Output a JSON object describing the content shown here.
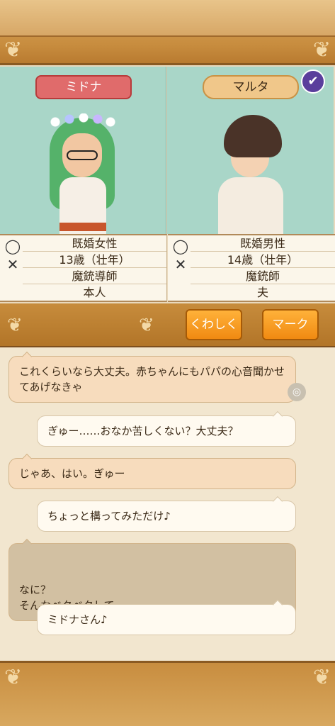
{
  "characters": {
    "left": {
      "name": "ミドナ",
      "info": [
        "既婚女性",
        "13歳（壮年）",
        "魔銃導師",
        "本人"
      ]
    },
    "right": {
      "name": "マルタ",
      "info": [
        "既婚男性",
        "14歳（壮年）",
        "魔銃師",
        "夫"
      ]
    }
  },
  "icons": {
    "check": "check-icon",
    "ring": "ring-icon",
    "crossed": "crossed-weapons-icon",
    "ornament": "ornament-icon"
  },
  "actions": {
    "details_label": "くわしく",
    "mark_label": "マーク"
  },
  "chat": [
    {
      "side": "partner",
      "text": "これくらいなら大丈夫。赤ちゃんにもパパの心音聞かせてあげなきゃ"
    },
    {
      "side": "self",
      "text": "ぎゅー……おなか苦しくない？大丈夫？"
    },
    {
      "side": "partner",
      "text": "じゃあ、はい。ぎゅー"
    },
    {
      "side": "self",
      "text": "ちょっと構ってみただけ♪"
    },
    {
      "side": "partner",
      "text": "なに？\nそんなベタベタして……"
    },
    {
      "side": "self",
      "text": "ミドナさん♪"
    }
  ],
  "colors": {
    "accent": "#f08a12",
    "name_left": "#e06b6b",
    "name_right": "#f0c78a",
    "portrait_bg": "#a9d6c8"
  }
}
